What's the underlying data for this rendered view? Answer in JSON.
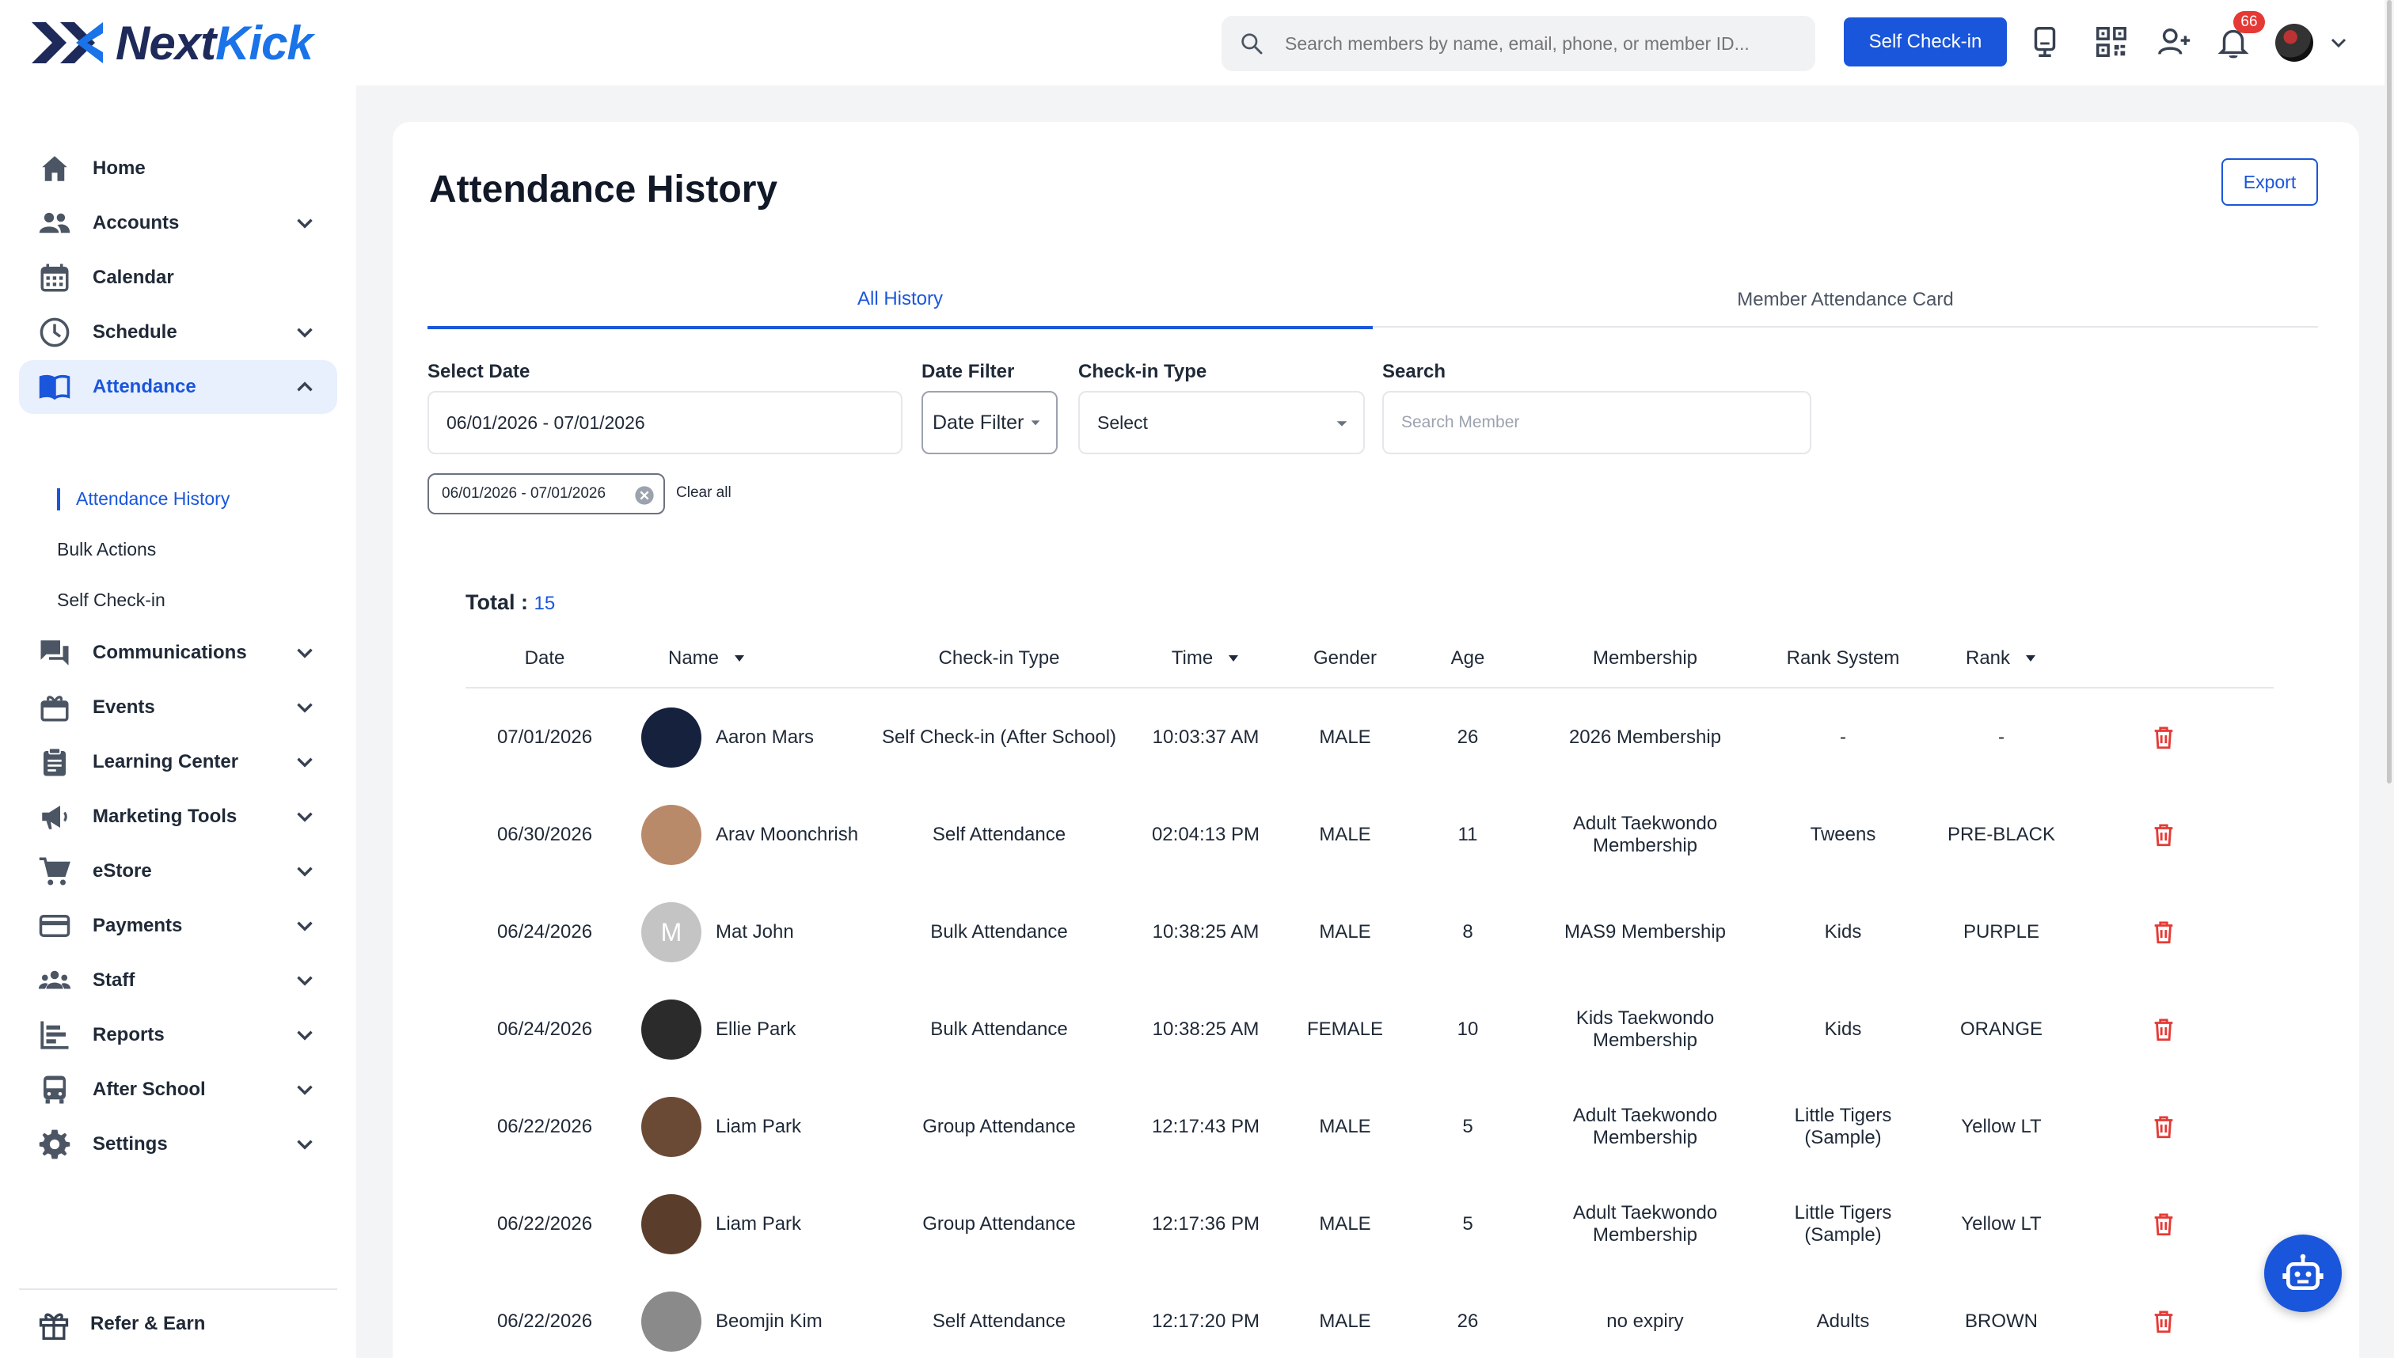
{
  "app": {
    "logo_part1": "Next",
    "logo_part2": "Kick"
  },
  "topbar": {
    "search_placeholder": "Search members by name, email, phone, or member ID...",
    "checkin_label": "Self Check-in",
    "notification_count": "66",
    "icons": [
      "kiosk-icon",
      "qr-code-icon",
      "add-user-icon",
      "bell-icon"
    ]
  },
  "sidebar": {
    "items": [
      {
        "label": "Home",
        "icon": "home-icon",
        "chevron": "none"
      },
      {
        "label": "Accounts",
        "icon": "people-icon",
        "chevron": "down"
      },
      {
        "label": "Calendar",
        "icon": "calendar-icon",
        "chevron": "none"
      },
      {
        "label": "Schedule",
        "icon": "clock-icon",
        "chevron": "down"
      },
      {
        "label": "Attendance",
        "icon": "book-icon",
        "chevron": "up",
        "active": true
      },
      {
        "label": "Communications",
        "icon": "chat-icon",
        "chevron": "down"
      },
      {
        "label": "Events",
        "icon": "events-icon",
        "chevron": "down"
      },
      {
        "label": "Learning Center",
        "icon": "clipboard-icon",
        "chevron": "down"
      },
      {
        "label": "Marketing Tools",
        "icon": "megaphone-icon",
        "chevron": "down"
      },
      {
        "label": "eStore",
        "icon": "cart-icon",
        "chevron": "down"
      },
      {
        "label": "Payments",
        "icon": "card-icon",
        "chevron": "down"
      },
      {
        "label": "Staff",
        "icon": "staff-icon",
        "chevron": "down"
      },
      {
        "label": "Reports",
        "icon": "reports-icon",
        "chevron": "down"
      },
      {
        "label": "After School",
        "icon": "bus-icon",
        "chevron": "down"
      },
      {
        "label": "Settings",
        "icon": "gear-icon",
        "chevron": "down"
      }
    ],
    "subitems": [
      {
        "label": "Attendance History",
        "active": true
      },
      {
        "label": "Bulk Actions"
      },
      {
        "label": "Self Check-in"
      }
    ],
    "refer_label": "Refer & Earn"
  },
  "main": {
    "title": "Attendance History",
    "export_label": "Export",
    "tabs": [
      {
        "label": "All History",
        "active": true
      },
      {
        "label": "Member Attendance Card"
      }
    ],
    "filters": {
      "select_date_label": "Select Date",
      "select_date_value": "06/01/2026 - 07/01/2026",
      "date_filter_label": "Date Filter",
      "date_filter_value": "Date Filter",
      "checkin_type_label": "Check-in Type",
      "checkin_type_value": "Select",
      "search_label": "Search",
      "search_placeholder": "Search Member"
    },
    "chip": "06/01/2026 - 07/01/2026",
    "clear_all": "Clear all",
    "total_label": "Total :",
    "total_value": "15"
  },
  "table": {
    "headers": [
      "Date",
      "Name",
      "Check-in Type",
      "Time",
      "Gender",
      "Age",
      "Membership",
      "Rank System",
      "Rank"
    ],
    "rows": [
      {
        "date": "07/01/2026",
        "name": "Aaron Mars",
        "checkin": "Self Check-in (After School)",
        "time": "10:03:37 AM",
        "gender": "MALE",
        "age": "26",
        "membership": "2026 Membership",
        "rank_system": "-",
        "rank": "-",
        "avatar_color": "#16213e"
      },
      {
        "date": "06/30/2026",
        "name": "Arav Moonchrish",
        "checkin": "Self Attendance",
        "time": "02:04:13 PM",
        "gender": "MALE",
        "age": "11",
        "membership": "Adult Taekwondo Membership",
        "rank_system": "Tweens",
        "rank": "PRE-BLACK",
        "avatar_color": "#b98a6a"
      },
      {
        "date": "06/24/2026",
        "name": "Mat John",
        "checkin": "Bulk Attendance",
        "time": "10:38:25 AM",
        "gender": "MALE",
        "age": "8",
        "membership": "MAS9 Membership",
        "rank_system": "Kids",
        "rank": "PURPLE",
        "avatar_color": "#c4c4c4",
        "initial": "M"
      },
      {
        "date": "06/24/2026",
        "name": "Ellie Park",
        "checkin": "Bulk Attendance",
        "time": "10:38:25 AM",
        "gender": "FEMALE",
        "age": "10",
        "membership": "Kids Taekwondo Membership",
        "rank_system": "Kids",
        "rank": "ORANGE",
        "avatar_color": "#2b2b2b"
      },
      {
        "date": "06/22/2026",
        "name": "Liam Park",
        "checkin": "Group Attendance",
        "time": "12:17:43 PM",
        "gender": "MALE",
        "age": "5",
        "membership": "Adult Taekwondo Membership",
        "rank_system": "Little Tigers (Sample)",
        "rank": "Yellow LT",
        "avatar_color": "#6b4a35"
      },
      {
        "date": "06/22/2026",
        "name": "Liam Park",
        "checkin": "Group Attendance",
        "time": "12:17:36 PM",
        "gender": "MALE",
        "age": "5",
        "membership": "Adult Taekwondo Membership",
        "rank_system": "Little Tigers (Sample)",
        "rank": "Yellow LT",
        "avatar_color": "#5a3e2b"
      },
      {
        "date": "06/22/2026",
        "name": "Beomjin Kim",
        "checkin": "Self Attendance",
        "time": "12:17:20 PM",
        "gender": "MALE",
        "age": "26",
        "membership": "no expiry",
        "rank_system": "Adults",
        "rank": "BROWN",
        "avatar_color": "#8a8a8a"
      }
    ]
  },
  "colors": {
    "accent": "#1a56db",
    "delete": "#e53935"
  }
}
